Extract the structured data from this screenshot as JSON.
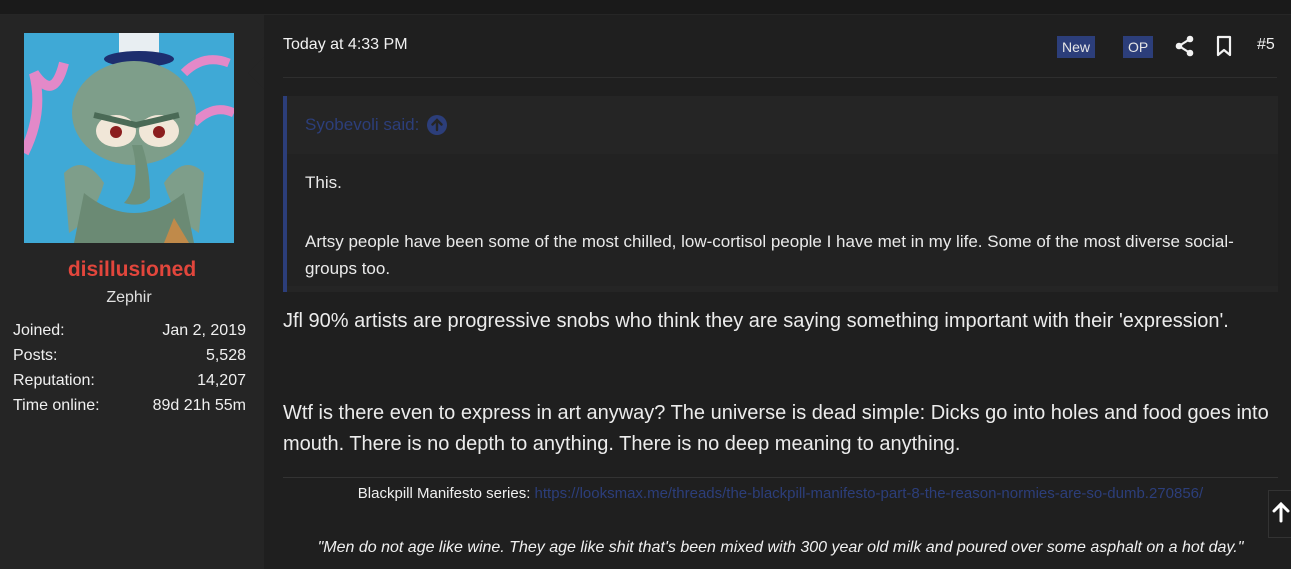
{
  "topbar": {},
  "user": {
    "name": "disillusioned",
    "title": "Zephir",
    "stats": [
      {
        "label": "Joined:",
        "value": "Jan 2, 2019"
      },
      {
        "label": "Posts:",
        "value": "5,528"
      },
      {
        "label": "Reputation:",
        "value": "14,207"
      },
      {
        "label": "Time online:",
        "value": "89d 21h 55m"
      }
    ]
  },
  "post": {
    "date": "Today at 4:33 PM",
    "badge_new": "New",
    "badge_op": "OP",
    "number": "#5",
    "quote": {
      "author": "Syobevoli said:",
      "line1": "This.",
      "line2": "Artsy people have been some of the most chilled, low-cortisol people I have met in my life. Some of the most diverse social-groups too."
    },
    "paragraph1": "Jfl 90% artists are progressive snobs who think they are saying something important with their 'expression'.",
    "paragraph2": "Wtf is there even to express in art anyway? The universe is dead simple: Dicks go into holes and food goes into mouth. There is no depth to anything. There is no deep meaning to anything.",
    "signature": {
      "label": "Blackpill Manifesto series:",
      "link": "https://looksmax.me/threads/the-blackpill-manifesto-part-8-the-reason-normies-are-so-dumb.270856/",
      "quote": "\"Men do not age like wine. They age like shit that's been mixed with 300 year old milk and poured over some asphalt on a hot day.\""
    }
  },
  "colors": {
    "username": "#e2463c",
    "accent": "#2c3e7a",
    "background": "#1f1f1f",
    "sidebar": "#252525"
  },
  "icons": [
    "share-icon",
    "bookmark-icon",
    "arrow-up-circle-icon",
    "scroll-top-icon"
  ]
}
